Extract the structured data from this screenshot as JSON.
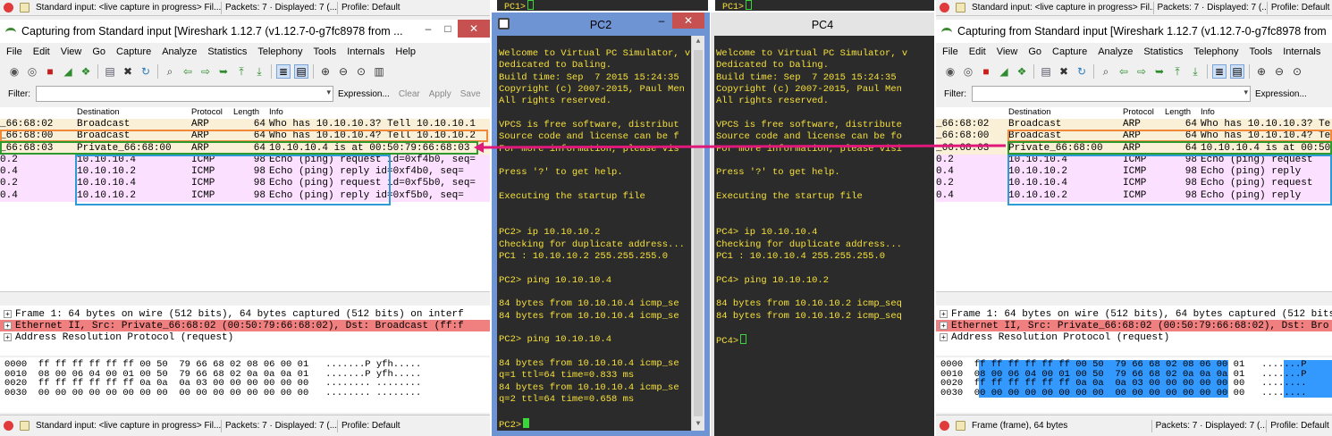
{
  "left_ws": {
    "top_status": {
      "capture": "Standard input: <live capture in progress> Fil...",
      "packets": "Packets: 7 · Displayed: 7 (...",
      "profile": "Profile: Default"
    },
    "title": "Capturing from Standard input   [Wireshark 1.12.7  (v1.12.7-0-g7fc8978 from ...",
    "filter": {
      "label": "Filter:",
      "expression": "Expression...",
      "clear": "Clear",
      "apply": "Apply",
      "save": "Save"
    },
    "columns": [
      "Destination",
      "Protocol",
      "Length",
      "Info"
    ],
    "rows": [
      {
        "src": "_66:68:02",
        "dst": "Broadcast",
        "proto": "ARP",
        "len": "64",
        "info": "Who has 10.10.10.3?  Tell 10.10.10.1",
        "kind": "arp"
      },
      {
        "src": "_66:68:00",
        "dst": "Broadcast",
        "proto": "ARP",
        "len": "64",
        "info": "Who has 10.10.10.4?  Tell 10.10.10.2",
        "kind": "arp"
      },
      {
        "src": "_66:68:03",
        "dst": "Private_66:68:00",
        "proto": "ARP",
        "len": "64",
        "info": "10.10.10.4 is at 00:50:79:66:68:03",
        "kind": "arp"
      },
      {
        "src": "0.2",
        "dst": "10.10.10.4",
        "proto": "ICMP",
        "len": "98",
        "info": "Echo (ping) request  id=0xf4b0, seq=",
        "kind": "icmp"
      },
      {
        "src": "0.4",
        "dst": "10.10.10.2",
        "proto": "ICMP",
        "len": "98",
        "info": "Echo (ping) reply    id=0xf4b0, seq=",
        "kind": "icmp"
      },
      {
        "src": "0.2",
        "dst": "10.10.10.4",
        "proto": "ICMP",
        "len": "98",
        "info": "Echo (ping) request  id=0xf5b0, seq=",
        "kind": "icmp"
      },
      {
        "src": "0.4",
        "dst": "10.10.10.2",
        "proto": "ICMP",
        "len": "98",
        "info": "Echo (ping) reply    id=0xf5b0, seq=",
        "kind": "icmp"
      }
    ],
    "details": [
      {
        "text": "Frame 1: 64 bytes on wire (512 bits), 64 bytes captured (512 bits) on interf",
        "hl": false
      },
      {
        "text": "Ethernet II, Src: Private_66:68:02 (00:50:79:66:68:02), Dst: Broadcast (ff:f",
        "hl": true
      },
      {
        "text": "Address Resolution Protocol (request)",
        "hl": false
      }
    ],
    "hex": [
      "0000  ff ff ff ff ff ff 00 50  79 66 68 02 08 06 00 01   .......P yfh.....",
      "0010  08 00 06 04 00 01 00 50  79 66 68 02 0a 0a 0a 01   .......P yfh.....",
      "0020  ff ff ff ff ff ff 0a 0a  0a 03 00 00 00 00 00 00   ........ ........",
      "0030  00 00 00 00 00 00 00 00  00 00 00 00 00 00 00 00   ........ ........"
    ],
    "bottom_status": {
      "capture": "Standard input: <live capture in progress> Fil...",
      "packets": "Packets: 7 · Displayed: 7 (...",
      "profile": "Profile: Default"
    }
  },
  "right_ws": {
    "top_status": {
      "capture": "Standard input: <live capture in progress> Fil...",
      "packets": "Packets: 7 · Displayed: 7 (...",
      "profile": "Profile: Default"
    },
    "title": "Capturing from Standard input   [Wireshark 1.12.7  (v1.12.7-0-g7fc8978 from",
    "filter": {
      "label": "Filter:",
      "expression": "Expression..."
    },
    "columns": [
      "Destination",
      "Protocol",
      "Length",
      "Info"
    ],
    "rows": [
      {
        "src": "_66:68:02",
        "dst": "Broadcast",
        "proto": "ARP",
        "len": "64",
        "info": "Who has 10.10.10.3?  Te",
        "kind": "arp"
      },
      {
        "src": "_66:68:00",
        "dst": "Broadcast",
        "proto": "ARP",
        "len": "64",
        "info": "Who has 10.10.10.4?  Te",
        "kind": "arp"
      },
      {
        "src": "_66:68:03",
        "dst": "Private_66:68:00",
        "proto": "ARP",
        "len": "64",
        "info": "10.10.10.4 is at 00:50",
        "kind": "arp"
      },
      {
        "src": "0.2",
        "dst": "10.10.10.4",
        "proto": "ICMP",
        "len": "98",
        "info": "Echo (ping) request",
        "kind": "icmp"
      },
      {
        "src": "0.4",
        "dst": "10.10.10.2",
        "proto": "ICMP",
        "len": "98",
        "info": "Echo (ping) reply",
        "kind": "icmp"
      },
      {
        "src": "0.2",
        "dst": "10.10.10.4",
        "proto": "ICMP",
        "len": "98",
        "info": "Echo (ping) request",
        "kind": "icmp"
      },
      {
        "src": "0.4",
        "dst": "10.10.10.2",
        "proto": "ICMP",
        "len": "98",
        "info": "Echo (ping) reply",
        "kind": "icmp"
      }
    ],
    "details": [
      {
        "text": "Frame 1: 64 bytes on wire (512 bits), 64 bytes captured (512 bits) on interf",
        "hl": false
      },
      {
        "text": "Ethernet II, Src: Private_66:68:02 (00:50:79:66:68:02), Dst: Bro",
        "hl": true
      },
      {
        "text": "Address Resolution Protocol (request)",
        "hl": false
      }
    ],
    "hex": [
      "0000  ff ff ff ff ff ff 00 50  79 66 68 02 08 06 00 01   .......P",
      "0010  08 00 06 04 00 01 00 50  79 66 68 02 0a 0a 0a 01   .......P",
      "0020  ff ff ff ff ff ff 0a 0a  0a 03 00 00 00 00 00 00   ........",
      "0030  00 00 00 00 00 00 00 00  00 00 00 00 00 00 00 00   ........"
    ],
    "bottom_status": {
      "capture": "Frame (frame), 64 bytes",
      "packets": "Packets: 7 · Displayed: 7 (...",
      "profile": "Profile: Default"
    }
  },
  "menu": [
    "File",
    "Edit",
    "View",
    "Go",
    "Capture",
    "Analyze",
    "Statistics",
    "Telephony",
    "Tools",
    "Internals",
    "Help"
  ],
  "pc1_strip": "PC1>",
  "pc2": {
    "title": "PC2",
    "lines": [
      "Welcome to Virtual PC Simulator, v",
      "Dedicated to Daling.",
      "Build time: Sep  7 2015 15:24:35",
      "Copyright (c) 2007-2015, Paul Men",
      "All rights reserved.",
      "",
      "VPCS is free software, distribut",
      "Source code and license can be f",
      "For more information, please vis",
      "",
      "Press '?' to get help.",
      "",
      "Executing the startup file",
      "",
      "",
      "PC2> ip 10.10.10.2",
      "Checking for duplicate address...",
      "PC1 : 10.10.10.2 255.255.255.0",
      "",
      "PC2> ping 10.10.10.4",
      "",
      "84 bytes from 10.10.10.4 icmp_se",
      "84 bytes from 10.10.10.4 icmp_se",
      "",
      "PC2> ping 10.10.10.4",
      "",
      "84 bytes from 10.10.10.4 icmp_se",
      "q=1 ttl=64 time=0.833 ms",
      "84 bytes from 10.10.10.4 icmp_se",
      "q=2 ttl=64 time=0.658 ms",
      "",
      "PC2>"
    ]
  },
  "pc4": {
    "title": "PC4",
    "lines": [
      "Welcome to Virtual PC Simulator, v",
      "Dedicated to Daling.",
      "Build time: Sep  7 2015 15:24:35",
      "Copyright (c) 2007-2015, Paul Men",
      "All rights reserved.",
      "",
      "VPCS is free software, distribute",
      "Source code and license can be fo",
      "For more information, please visi",
      "",
      "Press '?' to get help.",
      "",
      "Executing the startup file",
      "",
      "",
      "PC4> ip 10.10.10.4",
      "Checking for duplicate address...",
      "PC1 : 10.10.10.4 255.255.255.0",
      "",
      "PC4> ping 10.10.10.2",
      "",
      "84 bytes from 10.10.10.2 icmp_seq",
      "84 bytes from 10.10.10.2 icmp_seq",
      "",
      "PC4>"
    ]
  },
  "colors": {
    "arp_row": "#faf0d7",
    "icmp_row": "#fce0ff",
    "ethernet_row": "#f08080",
    "terminal_bg": "#2b2b2b",
    "terminal_text": "#f6e03a",
    "marker_orange": "#f08a3a",
    "marker_green": "#2e9a2e",
    "marker_blue": "#2f9bd6",
    "arrow": "#e0187a"
  }
}
